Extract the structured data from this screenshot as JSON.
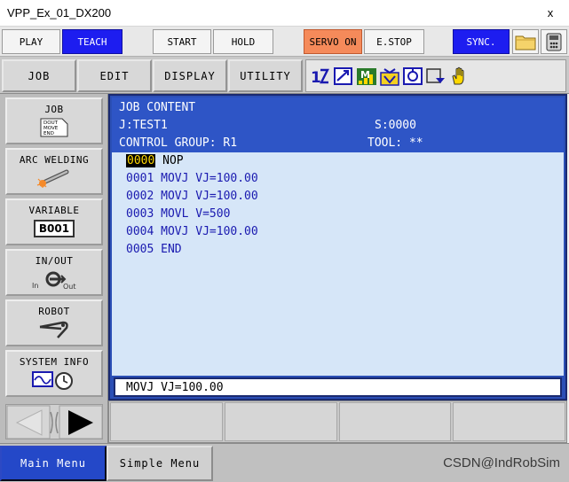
{
  "window": {
    "title": "VPP_Ex_01_DX200",
    "close_glyph": "x"
  },
  "topbar": {
    "play": "PLAY",
    "teach": "TEACH",
    "start": "START",
    "hold": "HOLD",
    "servo_on": "SERVO ON",
    "estop": "E.STOP",
    "sync": "SYNC."
  },
  "menu_tabs": {
    "job": "JOB",
    "edit": "EDIT",
    "display": "DISPLAY",
    "utility": "UTILITY"
  },
  "side_menu": {
    "job": "JOB",
    "job_icon_lines": [
      "DOUT",
      "MOVE",
      "END"
    ],
    "arc_welding": "ARC WELDING",
    "variable": "VARIABLE",
    "variable_badge": "B001",
    "in_out": "IN/OUT",
    "in_label": "In",
    "out_label": "Out",
    "robot": "ROBOT",
    "system_info": "SYSTEM INFO"
  },
  "job_content": {
    "title": "JOB CONTENT",
    "job_name": "J:TEST1",
    "step": "S:0000",
    "control_group": "CONTROL GROUP: R1",
    "tool": "TOOL: **",
    "lines": [
      {
        "num": "0000",
        "cmd": "NOP"
      },
      {
        "num": "0001",
        "cmd": "MOVJ VJ=100.00"
      },
      {
        "num": "0002",
        "cmd": "MOVJ VJ=100.00"
      },
      {
        "num": "0003",
        "cmd": "MOVL V=500"
      },
      {
        "num": "0004",
        "cmd": "MOVJ VJ=100.00"
      },
      {
        "num": "0005",
        "cmd": "END"
      }
    ],
    "edit_line": "MOVJ VJ=100.00"
  },
  "bottombar": {
    "main_menu": "Main Menu",
    "simple_menu": "Simple Menu",
    "watermark": "CSDN@IndRobSim"
  },
  "colors": {
    "accent_blue": "#1d1df0",
    "servo_orange": "#f58a5a",
    "panel_blue": "#2b4fb6",
    "code_bg": "#d6e6f8",
    "code_text": "#1a1ab0"
  }
}
